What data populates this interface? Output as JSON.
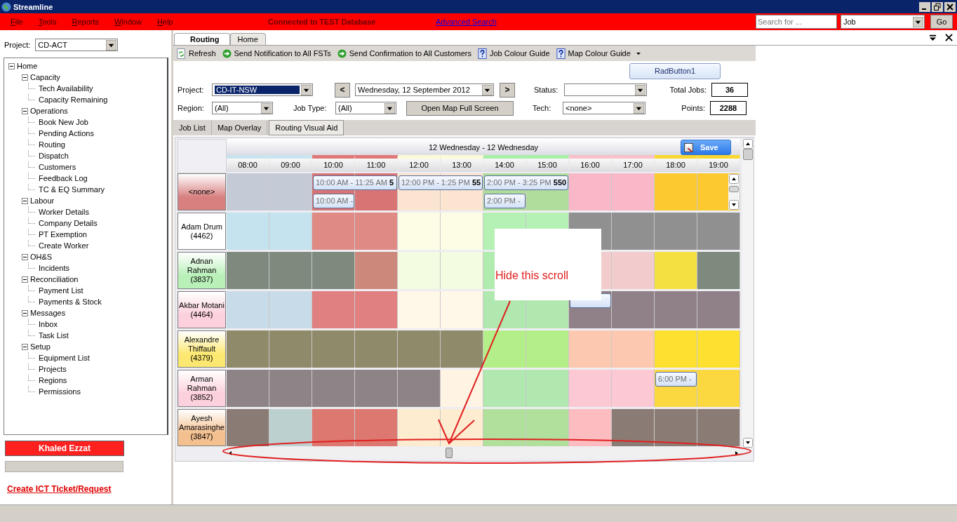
{
  "window": {
    "title": "Streamline"
  },
  "menu": [
    "File",
    "Tools",
    "Reports",
    "Window",
    "Help"
  ],
  "connection_status": "Connected to TEST Database",
  "advanced_search_link": "Advanced Search",
  "search": {
    "placeholder": "Search for ...",
    "type_value": "Job",
    "go_button": "Go"
  },
  "sidebar": {
    "project_label": "Project:",
    "project_value": "CD-ACT",
    "tree": [
      {
        "label": "Home",
        "expanded": true,
        "children": [
          {
            "label": "Capacity",
            "expanded": true,
            "children": [
              {
                "label": "Tech Availability"
              },
              {
                "label": "Capacity Remaining"
              }
            ]
          },
          {
            "label": "Operations",
            "expanded": true,
            "children": [
              {
                "label": "Book New Job"
              },
              {
                "label": "Pending Actions"
              },
              {
                "label": "Routing"
              },
              {
                "label": "Dispatch"
              },
              {
                "label": "Customers"
              },
              {
                "label": "Feedback Log"
              },
              {
                "label": "TC & EQ Summary"
              }
            ]
          },
          {
            "label": "Labour",
            "expanded": true,
            "children": [
              {
                "label": "Worker Details"
              },
              {
                "label": "Company Details"
              },
              {
                "label": "PT Exemption"
              },
              {
                "label": "Create Worker"
              }
            ]
          },
          {
            "label": "OH&S",
            "expanded": true,
            "children": [
              {
                "label": "Incidents"
              }
            ]
          },
          {
            "label": "Reconciliation",
            "expanded": true,
            "children": [
              {
                "label": "Payment List"
              },
              {
                "label": "Payments & Stock"
              }
            ]
          },
          {
            "label": "Messages",
            "expanded": true,
            "children": [
              {
                "label": "Inbox"
              },
              {
                "label": "Task List"
              }
            ]
          },
          {
            "label": "Setup",
            "expanded": true,
            "children": [
              {
                "label": "Equipment List"
              },
              {
                "label": "Projects"
              },
              {
                "label": "Regions"
              },
              {
                "label": "Permissions"
              }
            ]
          }
        ]
      }
    ],
    "user_name": "Khaled Ezzat",
    "ticket_link": "Create ICT Ticket/Request"
  },
  "tabs": [
    {
      "label": "Routing",
      "selected": true
    },
    {
      "label": "Home",
      "selected": false
    }
  ],
  "toolbar": [
    {
      "label": "Refresh",
      "kind": "refresh",
      "dropdown": false
    },
    {
      "label": "Send Notification to All FSTs",
      "kind": "send",
      "dropdown": false
    },
    {
      "label": "Send Confirmation to All Customers",
      "kind": "send",
      "dropdown": false
    },
    {
      "label": "Job Colour Guide",
      "kind": "guide",
      "dropdown": false
    },
    {
      "label": "Map Colour Guide",
      "kind": "guide",
      "dropdown": true
    }
  ],
  "rad_button": "RadButton1",
  "filters": {
    "project_label": "Project:",
    "project_value": "CD-IT-NSW",
    "prev_button": "<",
    "date_value": "Wednesday, 12 September 2012",
    "next_button": ">",
    "status_label": "Status:",
    "total_jobs_label": "Total Jobs:",
    "total_jobs": "36",
    "region_label": "Region:",
    "region_value": "(All)",
    "job_type_label": "Job Type:",
    "job_type_value": "(All)",
    "map_button": "Open Map Full Screen",
    "tech_label": "Tech:",
    "tech_value": "<none>",
    "points_label": "Points:",
    "points": "2288"
  },
  "view_tabs": [
    {
      "label": "Job List",
      "selected": false
    },
    {
      "label": "Map Overlay",
      "selected": false
    },
    {
      "label": "Routing Visual Aid",
      "selected": true
    }
  ],
  "schedule": {
    "date_range": "12 Wednesday - 12 Wednesday",
    "save_button": "Save",
    "hours": [
      {
        "label": "08:00",
        "color": "#c8e4f0"
      },
      {
        "label": "09:00",
        "color": "#c8e4f0"
      },
      {
        "label": "10:00",
        "color": "#e07878"
      },
      {
        "label": "11:00",
        "color": "#e07878"
      },
      {
        "label": "12:00",
        "color": "#fbfbd8"
      },
      {
        "label": "13:00",
        "color": "#fbfbd8"
      },
      {
        "label": "14:00",
        "color": "#a8eea8"
      },
      {
        "label": "15:00",
        "color": "#a8eea8"
      },
      {
        "label": "16:00",
        "color": "#f8c0c8"
      },
      {
        "label": "17:00",
        "color": "#f8c0c8"
      },
      {
        "label": "18:00",
        "color": "#f8d830"
      },
      {
        "label": "19:00",
        "color": "#f8d830"
      }
    ],
    "rows": [
      {
        "name": "<none>",
        "color": "#d88080",
        "scrollbar": true,
        "cells": [
          {
            "color": "#c4cad6"
          },
          {
            "color": "#c4cad6"
          },
          {
            "color": "#d97474",
            "jobs": [
              {
                "kind": "wide",
                "text": "10:00 AM - 11:25 AM **5**"
              },
              {
                "kind": "narrow",
                "text": "10:00 AM -"
              }
            ]
          },
          {
            "color": "#d97474"
          },
          {
            "color": "#fbe5d0",
            "jobs": [
              {
                "kind": "wide",
                "text": "12:00 PM - 1:25 PM **55**"
              }
            ]
          },
          {
            "color": "#fbe5d0"
          },
          {
            "color": "#b0dc9c",
            "jobs": [
              {
                "kind": "wide",
                "text": "2:00 PM - 3:25 PM **550**"
              },
              {
                "kind": "narrow",
                "text": "2:00 PM -"
              }
            ]
          },
          {
            "color": "#b0dc9c"
          },
          {
            "color": "#f9b8c8"
          },
          {
            "color": "#f9b8c8"
          },
          {
            "color": "#fcca30"
          },
          {
            "color": "#fcca30"
          }
        ]
      },
      {
        "name": "Adam Drum (4462)",
        "color": "#ffffff",
        "cells": [
          {
            "color": "#c5e3ee"
          },
          {
            "color": "#c5e3ee"
          },
          {
            "color": "#e08a86"
          },
          {
            "color": "#e08a86"
          },
          {
            "color": "#fdfde6"
          },
          {
            "color": "#fdfde6"
          },
          {
            "color": "#b5f0b5"
          },
          {
            "color": "#b5f0b5"
          },
          {
            "color": "#909090"
          },
          {
            "color": "#909090"
          },
          {
            "color": "#909090"
          },
          {
            "color": "#909090"
          }
        ]
      },
      {
        "name": "Adnan Rahman (3837)",
        "color": "#b8f0b8",
        "cells": [
          {
            "color": "#7e8a7e"
          },
          {
            "color": "#7e8a7e"
          },
          {
            "color": "#7e8a7e"
          },
          {
            "color": "#cc887a"
          },
          {
            "color": "#f3fbe0"
          },
          {
            "color": "#f3fbe0"
          },
          {
            "color": "#b0ecb0"
          },
          {},
          {
            "color": "#f2cccc"
          },
          {
            "color": "#f2cccc"
          },
          {
            "color": "#f4e040"
          },
          {
            "color": "#7e8a7e"
          }
        ]
      },
      {
        "name": "Akbar Motani (4464)",
        "color": "#fcd0dc",
        "cells": [
          {
            "color": "#c8dbe8"
          },
          {
            "color": "#c8dbe8"
          },
          {
            "color": "#e08080"
          },
          {
            "color": "#e08080"
          },
          {
            "color": "#fff8e8"
          },
          {
            "color": "#fff8e8"
          },
          {
            "color": "#b0e8b0"
          },
          {
            "color": "#b0e8b0"
          },
          {
            "color": "#908088",
            "jobs": [
              {
                "kind": "narrow"
              }
            ]
          },
          {
            "color": "#908088"
          },
          {
            "color": "#908088"
          },
          {
            "color": "#908088"
          }
        ]
      },
      {
        "name": "Alexandre Thiffault (4379)",
        "color": "#fce870",
        "cells": [
          {
            "color": "#8e8a6a"
          },
          {
            "color": "#8e8a6a"
          },
          {
            "color": "#8e8a6a"
          },
          {
            "color": "#8e8a6a"
          },
          {
            "color": "#8e8a6a"
          },
          {
            "color": "#8e8a6a"
          },
          {
            "color": "#b4ee88"
          },
          {
            "color": "#b4ee88"
          },
          {
            "color": "#fdc8b0"
          },
          {
            "color": "#fdc8b0"
          },
          {
            "color": "#fde030"
          },
          {
            "color": "#fde030"
          }
        ]
      },
      {
        "name": "Arman Rahman (3852)",
        "color": "#fcd0dc",
        "cells": [
          {
            "color": "#8e8488"
          },
          {
            "color": "#8e8488"
          },
          {
            "color": "#8e8488"
          },
          {
            "color": "#8e8488"
          },
          {
            "color": "#8e8488"
          },
          {
            "color": "#fff4e4"
          },
          {
            "color": "#b0e8b0"
          },
          {
            "color": "#b0e8b0"
          },
          {
            "color": "#fcc8d4"
          },
          {
            "color": "#fcc8d4"
          },
          {
            "color": "#fcd840",
            "jobs": [
              {
                "kind": "narrow",
                "text": "6:00 PM -"
              }
            ]
          },
          {
            "color": "#fcd840"
          }
        ]
      },
      {
        "name": "Ayesh Amarasinghe (3847)",
        "color": "#f4c090",
        "cells": [
          {
            "color": "#8a7c74"
          },
          {
            "color": "#bcd0d0"
          },
          {
            "color": "#dc7870"
          },
          {
            "color": "#dc7870"
          },
          {
            "color": "#fdecd0"
          },
          {
            "color": "#fdecd0"
          },
          {
            "color": "#b0e09c"
          },
          {
            "color": "#b0e09c"
          },
          {
            "color": "#fcbcc0"
          },
          {
            "color": "#8a7c74"
          },
          {
            "color": "#8a7c74"
          },
          {
            "color": "#8a7c74"
          }
        ]
      }
    ]
  },
  "annotation": {
    "text": "Hide this scroll"
  }
}
